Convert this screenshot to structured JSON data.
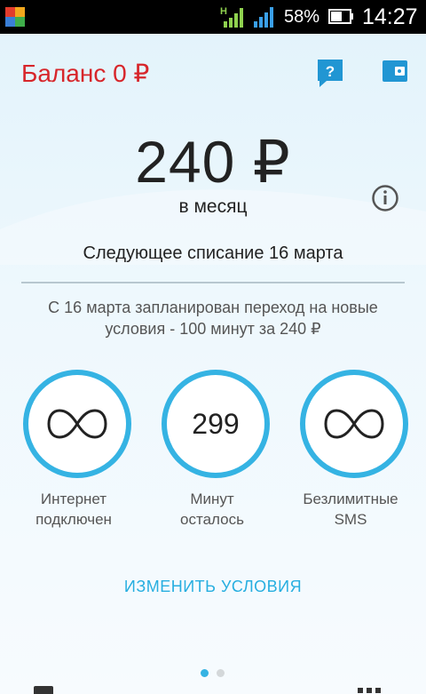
{
  "status_bar": {
    "network_type": "H",
    "battery_percent": "58%",
    "time": "14:27"
  },
  "header": {
    "balance": "Баланс 0 ₽"
  },
  "tariff": {
    "price": "240 ₽",
    "period": "в месяц",
    "next_charge": "Следующее списание 16 марта",
    "notice": "С 16 марта запланирован переход на новые условия - 100 минут за 240 ₽"
  },
  "counters": [
    {
      "value": "∞",
      "label_line1": "Интернет",
      "label_line2": "подключен"
    },
    {
      "value": "299",
      "label_line1": "Минут",
      "label_line2": "осталось"
    },
    {
      "value": "∞",
      "label_line1": "Безлимитные",
      "label_line2": "SMS"
    }
  ],
  "actions": {
    "change_terms": "ИЗМЕНИТЬ УСЛОВИЯ"
  },
  "pager": {
    "pages": 2,
    "current": 1
  },
  "colors": {
    "accent": "#35b3e3",
    "balance": "#d7262b",
    "link": "#27aee0"
  },
  "icons": [
    "help-icon",
    "wallet-icon",
    "info-icon",
    "infinity-icon"
  ]
}
